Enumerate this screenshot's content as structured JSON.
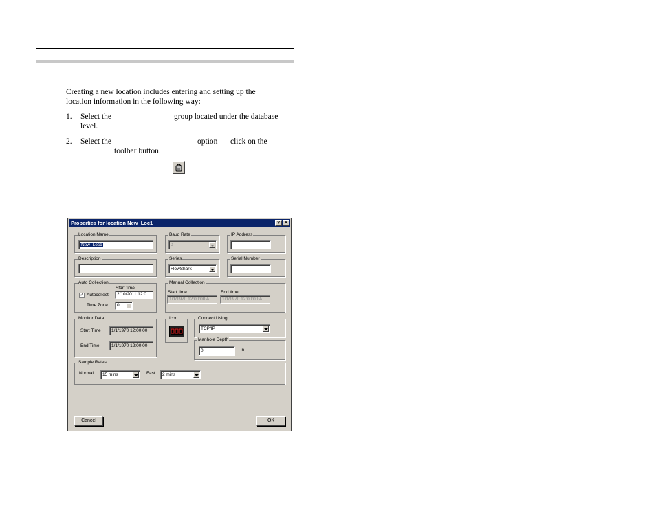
{
  "doc": {
    "intro_line1": "Creating a new location includes entering and setting up the",
    "intro_line2": "location information in the following way:",
    "step1_num": "1.",
    "step1_a": "Select the",
    "step1_b": "group located under the database",
    "step1_c": "level.",
    "step2_num": "2.",
    "step2_a": "Select the",
    "step2_b": "option",
    "step2_c": "click on the",
    "step2_d": "toolbar button."
  },
  "dialog": {
    "title": "Properties for location New_Loc1",
    "help_btn": "?",
    "close_btn": "✕",
    "location_name": {
      "label": "Location Name",
      "value": "New_Loc1"
    },
    "baud_rate": {
      "label": "Baud Rate",
      "value": "0"
    },
    "ip_address": {
      "label": "IP Address",
      "value": ""
    },
    "description": {
      "label": "Description",
      "value": ""
    },
    "series": {
      "label": "Series",
      "value": "FlowShark"
    },
    "serial_number": {
      "label": "Serial Number",
      "value": ""
    },
    "auto_collection": {
      "label": "Auto Collection",
      "start_time_label": "Start time",
      "autocollect_label": "Autocollect",
      "autocollect_check": "✓",
      "start_time_value": "2/10/2011 12:0",
      "time_zone_label": "Time Zone",
      "time_zone_value": "0"
    },
    "manual_collection": {
      "label": "Manual Collection",
      "start_label": "Start time",
      "end_label": "End time",
      "start_value": "1/1/1970 12:00:00 A",
      "end_value": "1/1/1970 12:00:00 A"
    },
    "monitor_data": {
      "label": "Monitor Data",
      "start_label": "Start Time",
      "start_value": "1/1/1970 12:00:00",
      "end_label": "End Time",
      "end_value": "1/1/1970 12:00:00"
    },
    "icon": {
      "label": "Icon"
    },
    "connect_using": {
      "label": "Connect Using",
      "value": "TCP/IP"
    },
    "manhole_depth": {
      "label": "Manhole Depth",
      "value": "0",
      "unit": "in"
    },
    "sample_rates": {
      "label": "Sample Rates",
      "normal_label": "Normal",
      "normal_value": "15 mins",
      "fast_label": "Fast",
      "fast_value": "2 mins"
    },
    "cancel_button": "Cancel",
    "ok_button": "OK"
  }
}
